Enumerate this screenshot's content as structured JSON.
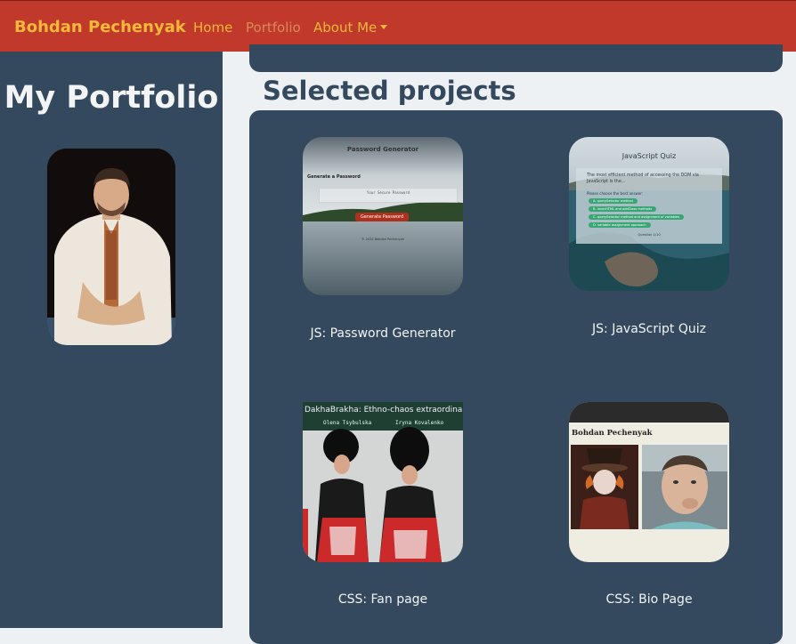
{
  "navbar": {
    "brand": "Bohdan Pechenyak",
    "links": [
      {
        "label": "Home"
      },
      {
        "label": "Portfolio"
      },
      {
        "label": "About Me"
      }
    ]
  },
  "sidebar": {
    "title": "My Portfolio"
  },
  "main": {
    "section_title": "Selected projects",
    "projects": [
      {
        "label": "JS: Password Generator",
        "thumb_title": "Password Generator",
        "thumb_subtitle": "Generate a Password",
        "thumb_field": "Your Secure Password",
        "thumb_button": "Generate Password",
        "thumb_footer": "© 2020 Bohdan Pechenyak"
      },
      {
        "label": "JS: JavaScript Quiz",
        "thumb_title": "JavaScript Quiz",
        "thumb_question": "The most efficient method of accessing the DOM via JavaScript is the...",
        "thumb_prompt": "Please choose the best answer:",
        "thumb_options": [
          "A. querySelector method",
          "B. innerHTML and addClass methods",
          "C. querySelector method and assignment of variables",
          "D. variable assignment approach"
        ],
        "thumb_counter": "Question 1/10"
      },
      {
        "label": "CSS: Fan page",
        "thumb_title": "DakhaBrakha: Ethno-chaos extraordinaire",
        "thumb_name_left": "Olena Tsybulska",
        "thumb_name_right": "Iryna Kovalenko"
      },
      {
        "label": "CSS: Bio Page",
        "thumb_title": "Bohdan Pechenyak"
      }
    ]
  },
  "colors": {
    "navbar": "#c0392b",
    "brand": "#f5b83a",
    "panel": "#34495e",
    "page": "#eef1f4"
  }
}
